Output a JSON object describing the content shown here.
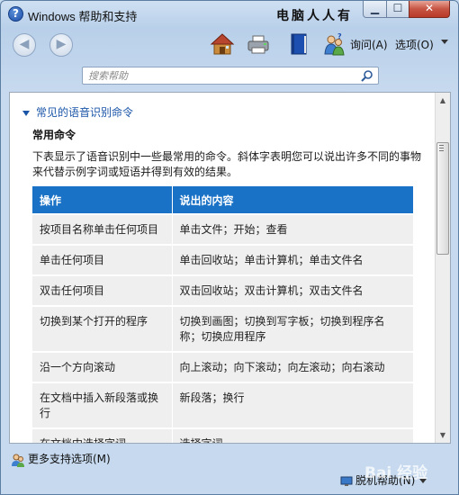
{
  "window": {
    "title": "Windows 帮助和支持",
    "watermark": "电脑人人有",
    "controls": {
      "minimize": "▁",
      "maximize": "☐",
      "close": "✕"
    }
  },
  "toolbar": {
    "back_glyph": "◀",
    "forward_glyph": "▶",
    "icons": [
      "home-icon",
      "print-icon",
      "browse-help-book-icon",
      "ask-people-icon"
    ],
    "ask_label": "询问(A)",
    "options_label": "选项(O)"
  },
  "search": {
    "placeholder": "搜索帮助"
  },
  "content": {
    "section_title": "常见的语音识别命令",
    "sub_heading": "常用命令",
    "intro": "下表显示了语音识别中一些最常用的命令。斜体字表明您可以说出许多不同的事物来代替示例字词或短语并得到有效的结果。",
    "table": {
      "headers": [
        "操作",
        "说出的内容"
      ],
      "rows": [
        [
          "按项目名称单击任何项目",
          "单击文件；开始；查看"
        ],
        [
          "单击任何项目",
          "单击回收站；单击计算机；单击文件名"
        ],
        [
          "双击任何项目",
          "双击回收站；双击计算机；双击文件名"
        ],
        [
          "切换到某个打开的程序",
          "切换到画图；切换到写字板；切换到程序名称；切换应用程序"
        ],
        [
          "沿一个方向滚动",
          "向上滚动；向下滚动；向左滚动；向右滚动"
        ],
        [
          "在文档中插入新段落或换行",
          "新段落；换行"
        ],
        [
          "在文档中选择字词",
          "选择字词"
        ]
      ]
    }
  },
  "statusbar": {
    "more_support": "更多支持选项(M)",
    "offline_help": "脱机帮助(N)",
    "overlay": "Bai 经验"
  }
}
